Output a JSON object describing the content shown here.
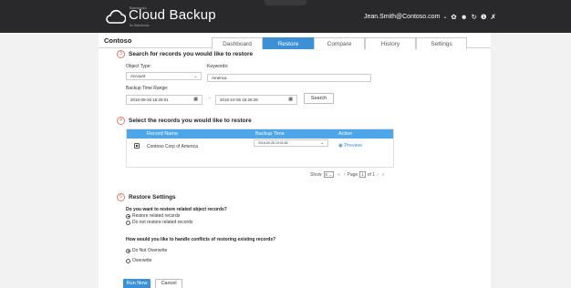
{
  "header": {
    "brand": "Barracuda",
    "app_name": "Cloud Backup",
    "app_sub": "for Salesforce",
    "user_email": "Jean.Smith@Contoso.com",
    "icons": [
      "gear-icon",
      "help-icon",
      "refresh-icon",
      "info-icon",
      "tools-icon"
    ]
  },
  "tenant": "Contoso",
  "tabs": [
    {
      "label": "Dashboard",
      "active": false
    },
    {
      "label": "Restore",
      "active": true
    },
    {
      "label": "Compare",
      "active": false
    },
    {
      "label": "History",
      "active": false
    },
    {
      "label": "Settings",
      "active": false
    }
  ],
  "search_section": {
    "number": "3",
    "title": "Search for records you would like to restore",
    "object_type_label": "Object Type:",
    "object_type_value": "Account",
    "keywords_label": "Keywords:",
    "keywords_value": "America",
    "time_range_label": "Backup Time Range:",
    "time_from": "2016-09-25 16:28:01",
    "time_sep": "-",
    "time_to": "2016-10-06 16:28:28",
    "search_button": "Search"
  },
  "select_section": {
    "number": "4",
    "title": "Select the records you would like to restore",
    "columns": [
      "Record Name",
      "Backup Time",
      "Action"
    ],
    "rows": [
      {
        "name": "Contoso Corp of America",
        "backup_time": "2016-09-26 15:02:26",
        "action": "Preview"
      }
    ],
    "pager": {
      "show_label": "Show",
      "show_value": "5",
      "page_label": "Page",
      "page_value": "1",
      "of_label": "of 1"
    }
  },
  "restore_section": {
    "number": "5",
    "title": "Restore Settings",
    "q1": "Do you want to restore related object records?",
    "q1_options": [
      {
        "label": "Restore related records",
        "selected": true
      },
      {
        "label": "Do not restore related records",
        "selected": false
      }
    ],
    "q2": "How would you like to handle conflicts of restoring existing records?",
    "q2_options": [
      {
        "label": "Do Not Overwrite",
        "selected": true
      },
      {
        "label": "Overwrite",
        "selected": false
      }
    ]
  },
  "actions": {
    "run_now": "Run Now",
    "cancel": "Cancel"
  }
}
